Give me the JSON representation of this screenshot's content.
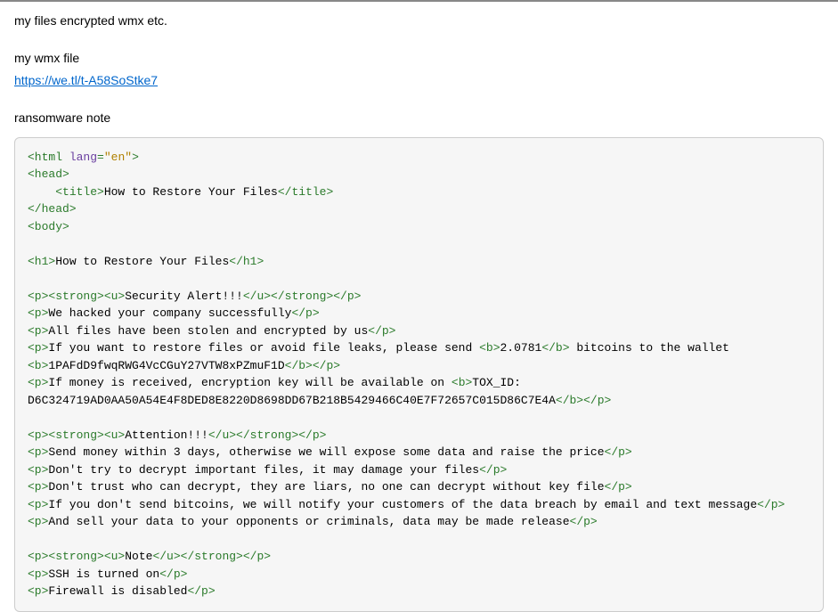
{
  "post": {
    "line1": "my files encrypted wmx etc.",
    "line2": "my wmx file",
    "link_text": "https://we.tl/t-A58SoStke7",
    "line3": "ransomware note"
  },
  "code": {
    "l01": {
      "a": "<html ",
      "b": "lang",
      "c": "=",
      "d": "\"en\"",
      "e": ">"
    },
    "l02": {
      "a": "<head>"
    },
    "l03": {
      "ind": "    ",
      "a": "<title>",
      "t": "How to Restore Your Files",
      "b": "</title>"
    },
    "l04": {
      "a": "</head>"
    },
    "l05": {
      "a": "<body>"
    },
    "l06": {
      "a": "<h1>",
      "t": "How to Restore Your Files",
      "b": "</h1>"
    },
    "l07": {
      "a": "<p><strong><u>",
      "t": "Security Alert!!!",
      "b": "</u></strong></p>"
    },
    "l08": {
      "a": "<p>",
      "t": "We hacked your company successfully",
      "b": "</p>"
    },
    "l09": {
      "a": "<p>",
      "t": "All files have been stolen and encrypted by us",
      "b": "</p>"
    },
    "l10": {
      "a": "<p>",
      "t1": "If you want to restore files or avoid file leaks, please send ",
      "b1": "<b>",
      "t2": "2.0781",
      "b2": "</b>",
      "t3": " bitcoins to the wallet "
    },
    "l11": {
      "a": "<b>",
      "t": "1PAFdD9fwqRWG4VcCGuY27VTW8xPZmuF1D",
      "b": "</b></p>"
    },
    "l12": {
      "a": "<p>",
      "t1": "If money is received, encryption key will be available on ",
      "b1": "<b>",
      "t2": "TOX_ID:"
    },
    "l13": {
      "t": "D6C324719AD0AA50A54E4F8DED8E8220D8698DD67B218B5429466C40E7F72657C015D86C7E4A",
      "b": "</b></p>"
    },
    "l14": {
      "a": "<p><strong><u>",
      "t": "Attention!!!",
      "b": "</u></strong></p>"
    },
    "l15": {
      "a": "<p>",
      "t": "Send money within 3 days, otherwise we will expose some data and raise the price",
      "b": "</p>"
    },
    "l16": {
      "a": "<p>",
      "t": "Don't try to decrypt important files, it may damage your files",
      "b": "</p>"
    },
    "l17": {
      "a": "<p>",
      "t": "Don't trust who can decrypt, they are liars, no one can decrypt without key file",
      "b": "</p>"
    },
    "l18": {
      "a": "<p>",
      "t": "If you don't send bitcoins, we will notify your customers of the data breach by email and text message",
      "b": "</p>"
    },
    "l19": {
      "a": "<p>",
      "t": "And sell your data to your opponents or criminals, data may be made release",
      "b": "</p>"
    },
    "l20": {
      "a": "<p><strong><u>",
      "t": "Note",
      "b": "</u></strong></p>"
    },
    "l21": {
      "a": "<p>",
      "t": "SSH is turned on",
      "b": "</p>"
    },
    "l22": {
      "a": "<p>",
      "t": "Firewall is disabled",
      "b": "</p>"
    }
  }
}
